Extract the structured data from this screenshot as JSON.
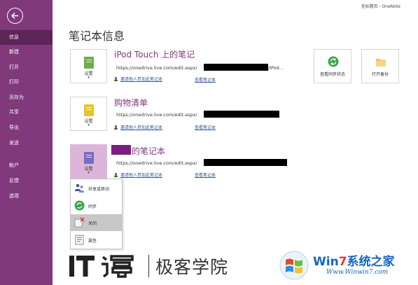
{
  "titlebar": {
    "text": "无标题页 - OneNote"
  },
  "sidebar": {
    "items": [
      {
        "label": "信息",
        "active": true
      },
      {
        "label": "新建"
      },
      {
        "label": "打开"
      },
      {
        "label": "打印"
      },
      {
        "label": "另存为"
      },
      {
        "label": "共享"
      },
      {
        "label": "导出"
      },
      {
        "label": "发送"
      },
      {
        "label": "帐户"
      },
      {
        "label": "反馈"
      },
      {
        "label": "选项"
      }
    ]
  },
  "page": {
    "title": "笔记本信息"
  },
  "notebooks": [
    {
      "name": "iPod Touch 上的笔记",
      "url_prefix": "https://onedrive.live.com/edit.aspx/",
      "url_suffix": "/iPod...",
      "settings_label": "设置",
      "invite_label": "邀请他人参加此笔记本",
      "view_label": "查看笔记本",
      "color": "#6ab04c"
    },
    {
      "name": "购物清单",
      "url_prefix": "https://onedrive.live.com/edit.aspx/",
      "url_suffix": "",
      "settings_label": "设置",
      "invite_label": "邀请他人参加此笔记本",
      "view_label": "查看笔记本",
      "color": "#e6c430"
    },
    {
      "name": "的笔记本",
      "url_prefix": "https://onedrive.live.com/edit.aspx/",
      "url_suffix": "",
      "settings_label": "设置",
      "invite_label": "邀请他人参加此笔记本",
      "view_label": "查看笔记本",
      "color": "#7a6bc4"
    }
  ],
  "actions": {
    "sync_status": "查看同步状态",
    "open_backup": "打开备份"
  },
  "menu": {
    "items": [
      {
        "label": "共享或移动",
        "icon": "share-icon"
      },
      {
        "label": "同步",
        "icon": "sync-icon"
      },
      {
        "label": "关闭",
        "icon": "close-notebook-icon",
        "highlight": true
      },
      {
        "label": "属性",
        "icon": "properties-icon"
      }
    ]
  },
  "watermarks": {
    "ithome": "极客学院",
    "win7_brand_a": "Win",
    "win7_brand_b": "7",
    "win7_brand_c": "系统之家",
    "win7_url": "Www.Winwin7.com"
  },
  "colors": {
    "accent": "#80397b",
    "accent_dark": "#5d2458",
    "link": "#2b5797",
    "selected_tile": "#dcb6d8"
  }
}
